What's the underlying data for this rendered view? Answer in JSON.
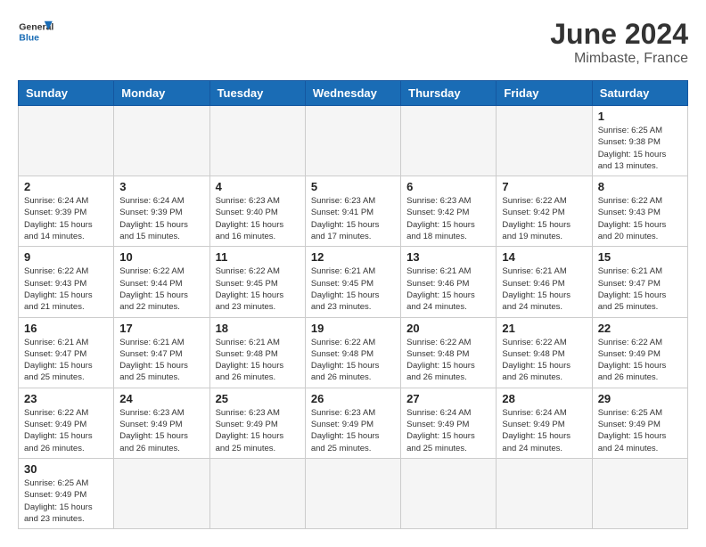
{
  "header": {
    "logo_general": "General",
    "logo_blue": "Blue",
    "month_year": "June 2024",
    "location": "Mimbaste, France"
  },
  "weekdays": [
    "Sunday",
    "Monday",
    "Tuesday",
    "Wednesday",
    "Thursday",
    "Friday",
    "Saturday"
  ],
  "days": {
    "d1": {
      "num": "1",
      "sunrise": "Sunrise: 6:25 AM",
      "sunset": "Sunset: 9:38 PM",
      "daylight": "Daylight: 15 hours and 13 minutes."
    },
    "d2": {
      "num": "2",
      "sunrise": "Sunrise: 6:24 AM",
      "sunset": "Sunset: 9:39 PM",
      "daylight": "Daylight: 15 hours and 14 minutes."
    },
    "d3": {
      "num": "3",
      "sunrise": "Sunrise: 6:24 AM",
      "sunset": "Sunset: 9:39 PM",
      "daylight": "Daylight: 15 hours and 15 minutes."
    },
    "d4": {
      "num": "4",
      "sunrise": "Sunrise: 6:23 AM",
      "sunset": "Sunset: 9:40 PM",
      "daylight": "Daylight: 15 hours and 16 minutes."
    },
    "d5": {
      "num": "5",
      "sunrise": "Sunrise: 6:23 AM",
      "sunset": "Sunset: 9:41 PM",
      "daylight": "Daylight: 15 hours and 17 minutes."
    },
    "d6": {
      "num": "6",
      "sunrise": "Sunrise: 6:23 AM",
      "sunset": "Sunset: 9:42 PM",
      "daylight": "Daylight: 15 hours and 18 minutes."
    },
    "d7": {
      "num": "7",
      "sunrise": "Sunrise: 6:22 AM",
      "sunset": "Sunset: 9:42 PM",
      "daylight": "Daylight: 15 hours and 19 minutes."
    },
    "d8": {
      "num": "8",
      "sunrise": "Sunrise: 6:22 AM",
      "sunset": "Sunset: 9:43 PM",
      "daylight": "Daylight: 15 hours and 20 minutes."
    },
    "d9": {
      "num": "9",
      "sunrise": "Sunrise: 6:22 AM",
      "sunset": "Sunset: 9:43 PM",
      "daylight": "Daylight: 15 hours and 21 minutes."
    },
    "d10": {
      "num": "10",
      "sunrise": "Sunrise: 6:22 AM",
      "sunset": "Sunset: 9:44 PM",
      "daylight": "Daylight: 15 hours and 22 minutes."
    },
    "d11": {
      "num": "11",
      "sunrise": "Sunrise: 6:22 AM",
      "sunset": "Sunset: 9:45 PM",
      "daylight": "Daylight: 15 hours and 23 minutes."
    },
    "d12": {
      "num": "12",
      "sunrise": "Sunrise: 6:21 AM",
      "sunset": "Sunset: 9:45 PM",
      "daylight": "Daylight: 15 hours and 23 minutes."
    },
    "d13": {
      "num": "13",
      "sunrise": "Sunrise: 6:21 AM",
      "sunset": "Sunset: 9:46 PM",
      "daylight": "Daylight: 15 hours and 24 minutes."
    },
    "d14": {
      "num": "14",
      "sunrise": "Sunrise: 6:21 AM",
      "sunset": "Sunset: 9:46 PM",
      "daylight": "Daylight: 15 hours and 24 minutes."
    },
    "d15": {
      "num": "15",
      "sunrise": "Sunrise: 6:21 AM",
      "sunset": "Sunset: 9:47 PM",
      "daylight": "Daylight: 15 hours and 25 minutes."
    },
    "d16": {
      "num": "16",
      "sunrise": "Sunrise: 6:21 AM",
      "sunset": "Sunset: 9:47 PM",
      "daylight": "Daylight: 15 hours and 25 minutes."
    },
    "d17": {
      "num": "17",
      "sunrise": "Sunrise: 6:21 AM",
      "sunset": "Sunset: 9:47 PM",
      "daylight": "Daylight: 15 hours and 25 minutes."
    },
    "d18": {
      "num": "18",
      "sunrise": "Sunrise: 6:21 AM",
      "sunset": "Sunset: 9:48 PM",
      "daylight": "Daylight: 15 hours and 26 minutes."
    },
    "d19": {
      "num": "19",
      "sunrise": "Sunrise: 6:22 AM",
      "sunset": "Sunset: 9:48 PM",
      "daylight": "Daylight: 15 hours and 26 minutes."
    },
    "d20": {
      "num": "20",
      "sunrise": "Sunrise: 6:22 AM",
      "sunset": "Sunset: 9:48 PM",
      "daylight": "Daylight: 15 hours and 26 minutes."
    },
    "d21": {
      "num": "21",
      "sunrise": "Sunrise: 6:22 AM",
      "sunset": "Sunset: 9:48 PM",
      "daylight": "Daylight: 15 hours and 26 minutes."
    },
    "d22": {
      "num": "22",
      "sunrise": "Sunrise: 6:22 AM",
      "sunset": "Sunset: 9:49 PM",
      "daylight": "Daylight: 15 hours and 26 minutes."
    },
    "d23": {
      "num": "23",
      "sunrise": "Sunrise: 6:22 AM",
      "sunset": "Sunset: 9:49 PM",
      "daylight": "Daylight: 15 hours and 26 minutes."
    },
    "d24": {
      "num": "24",
      "sunrise": "Sunrise: 6:23 AM",
      "sunset": "Sunset: 9:49 PM",
      "daylight": "Daylight: 15 hours and 26 minutes."
    },
    "d25": {
      "num": "25",
      "sunrise": "Sunrise: 6:23 AM",
      "sunset": "Sunset: 9:49 PM",
      "daylight": "Daylight: 15 hours and 25 minutes."
    },
    "d26": {
      "num": "26",
      "sunrise": "Sunrise: 6:23 AM",
      "sunset": "Sunset: 9:49 PM",
      "daylight": "Daylight: 15 hours and 25 minutes."
    },
    "d27": {
      "num": "27",
      "sunrise": "Sunrise: 6:24 AM",
      "sunset": "Sunset: 9:49 PM",
      "daylight": "Daylight: 15 hours and 25 minutes."
    },
    "d28": {
      "num": "28",
      "sunrise": "Sunrise: 6:24 AM",
      "sunset": "Sunset: 9:49 PM",
      "daylight": "Daylight: 15 hours and 24 minutes."
    },
    "d29": {
      "num": "29",
      "sunrise": "Sunrise: 6:25 AM",
      "sunset": "Sunset: 9:49 PM",
      "daylight": "Daylight: 15 hours and 24 minutes."
    },
    "d30": {
      "num": "30",
      "sunrise": "Sunrise: 6:25 AM",
      "sunset": "Sunset: 9:49 PM",
      "daylight": "Daylight: 15 hours and 23 minutes."
    }
  }
}
